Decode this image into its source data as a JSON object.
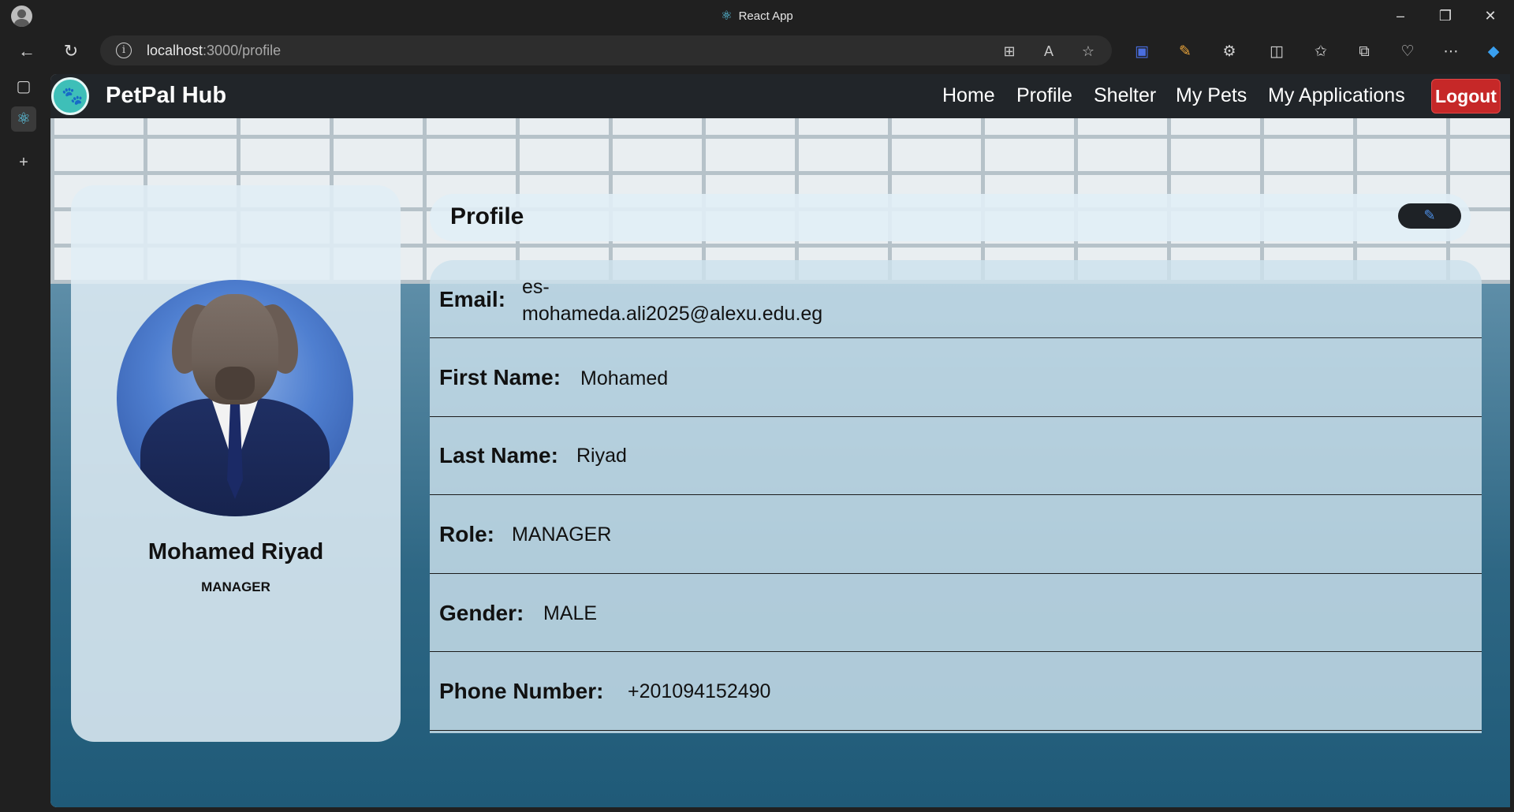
{
  "window": {
    "title": "React App",
    "url_host": "localhost",
    "url_path": ":3000/profile"
  },
  "app": {
    "brand": "PetPal Hub",
    "nav": [
      "Home",
      "Profile",
      "Shelter",
      "My Pets",
      "My Applications"
    ],
    "logout_label": "Logout"
  },
  "profile_card": {
    "name": "Mohamed Riyad",
    "role": "MANAGER"
  },
  "details": {
    "title": "Profile",
    "fields": [
      {
        "label": "Email:",
        "value_line1": "es-",
        "value_line2": "mohameda.ali2025@alexu.edu.eg"
      },
      {
        "label": "First Name:",
        "value": "Mohamed"
      },
      {
        "label": "Last Name:",
        "value": "Riyad"
      },
      {
        "label": "Role:",
        "value": "MANAGER"
      },
      {
        "label": "Gender:",
        "value": "MALE"
      },
      {
        "label": "Phone Number:",
        "value": "+201094152490"
      }
    ]
  },
  "colors": {
    "navbar": "#212529",
    "logout": "#c62828",
    "logo": "#3ebfb8"
  }
}
